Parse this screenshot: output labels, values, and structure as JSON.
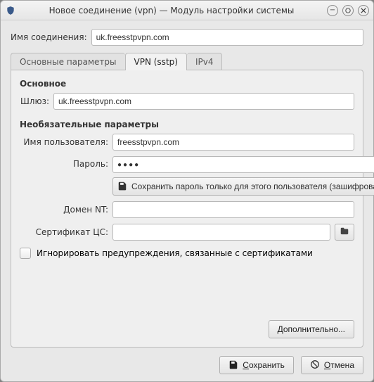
{
  "window": {
    "title": "Новое соединение (vpn) — Модуль настройки системы"
  },
  "conn_name": {
    "label": "Имя соединения:",
    "value": "uk.freesstpvpn.com"
  },
  "tabs": {
    "general": "Основные параметры",
    "vpn": "VPN (sstp)",
    "ipv4": "IPv4"
  },
  "vpn_panel": {
    "section_main": "Основное",
    "gateway_label": "Шлюз:",
    "gateway_value": "uk.freesstpvpn.com",
    "section_optional": "Необязательные параметры",
    "user_label": "Имя пользователя:",
    "user_value": "freesstpvpn.com",
    "password_label": "Пароль:",
    "password_value": "●●●●",
    "password_save_btn": "Сохранить пароль только для этого пользователя (зашифрованный)",
    "ntdomain_label": "Домен NT:",
    "ntdomain_value": "",
    "cert_label": "Сертификат ЦС:",
    "cert_value": "",
    "ignore_warn": "Игнорировать предупреждения, связанные с сертификатами",
    "advanced_btn": "Дополнительно..."
  },
  "footer": {
    "save_letter": "С",
    "save_rest": "охранить",
    "cancel_letter": "О",
    "cancel_rest": "тмена"
  },
  "icons": {
    "app": "shield",
    "minimize": "−",
    "maximize": "◯",
    "close": "✕",
    "eye": "eye",
    "save": "floppy",
    "browse": "folder",
    "cancel": "stop"
  }
}
